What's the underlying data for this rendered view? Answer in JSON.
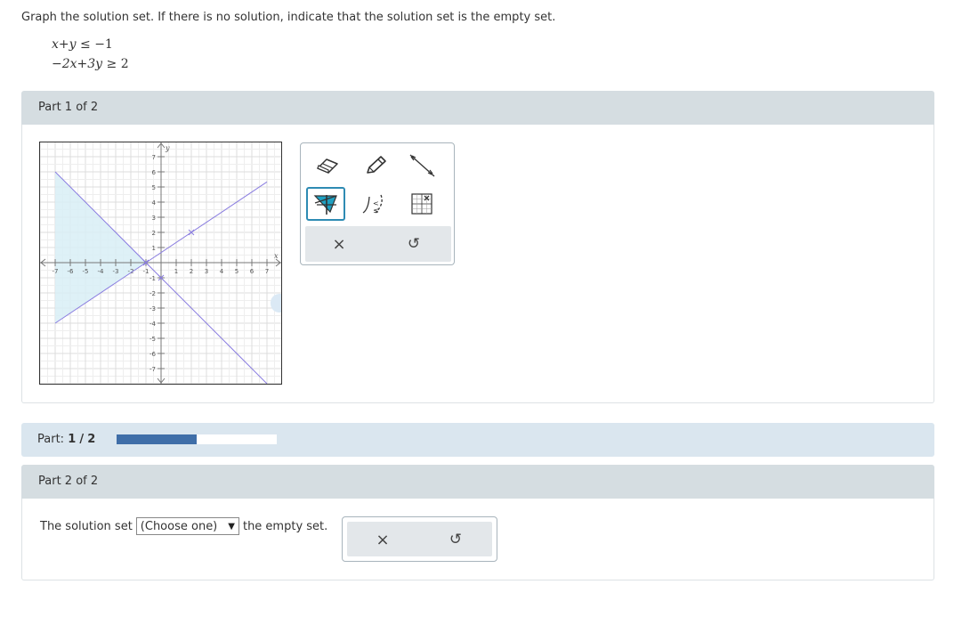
{
  "prompt": "Graph the solution set. If there is no solution, indicate that the solution set is the empty set.",
  "inequalities": {
    "first": {
      "lhs": "x+y",
      "op": "≤",
      "rhs": "−1"
    },
    "second": {
      "lhs": "−2x+3y",
      "op": "≥",
      "rhs": "2"
    }
  },
  "part1": {
    "title": "Part 1 of 2"
  },
  "graph": {
    "axis_x_label": "x",
    "axis_y_label": "y",
    "x_ticks": [
      "-7",
      "-6",
      "-5",
      "-4",
      "-3",
      "-2",
      "-1",
      "1",
      "2",
      "3",
      "4",
      "5",
      "6",
      "7"
    ],
    "y_ticks": [
      "7",
      "6",
      "5",
      "4",
      "3",
      "2",
      "1",
      "-1",
      "-2",
      "-3",
      "-4",
      "-5",
      "-6",
      "-7"
    ],
    "xlim": [
      -7,
      7
    ],
    "ylim": [
      -7,
      7
    ],
    "lines": [
      {
        "equation": "x+y=-1",
        "points": [
          [
            -7,
            6
          ],
          [
            7,
            -8
          ]
        ],
        "marked": [
          [
            -1,
            0
          ],
          [
            0,
            -1
          ]
        ]
      },
      {
        "equation": "-2x+3y=2",
        "points": [
          [
            -7,
            -4
          ],
          [
            7,
            5.333
          ]
        ],
        "marked": [
          [
            -1,
            0
          ],
          [
            2,
            2
          ]
        ]
      }
    ],
    "shaded_region": [
      [
        -7,
        6
      ],
      [
        -1,
        0
      ],
      [
        -7,
        -4
      ]
    ],
    "line_color": "#8a7de0",
    "shade_color": "#d8eef6"
  },
  "tools": {
    "eraser": "eraser-icon",
    "pencil": "pencil-icon",
    "line": "line-icon",
    "shade": "fill-region-icon",
    "dashed": "dashed-curve-icon",
    "point_grid": "point-grid-icon",
    "clear": "×",
    "undo": "↺"
  },
  "progress": {
    "label": "Part:",
    "current": "1",
    "separator": "/",
    "total": "2",
    "fraction": 0.5,
    "fill_color": "#3f6ea8"
  },
  "part2": {
    "title": "Part 2 of 2",
    "sentence_before": "The solution set",
    "select_value": "(Choose one)",
    "sentence_after": "the empty set.",
    "clear": "×",
    "undo": "↺"
  }
}
